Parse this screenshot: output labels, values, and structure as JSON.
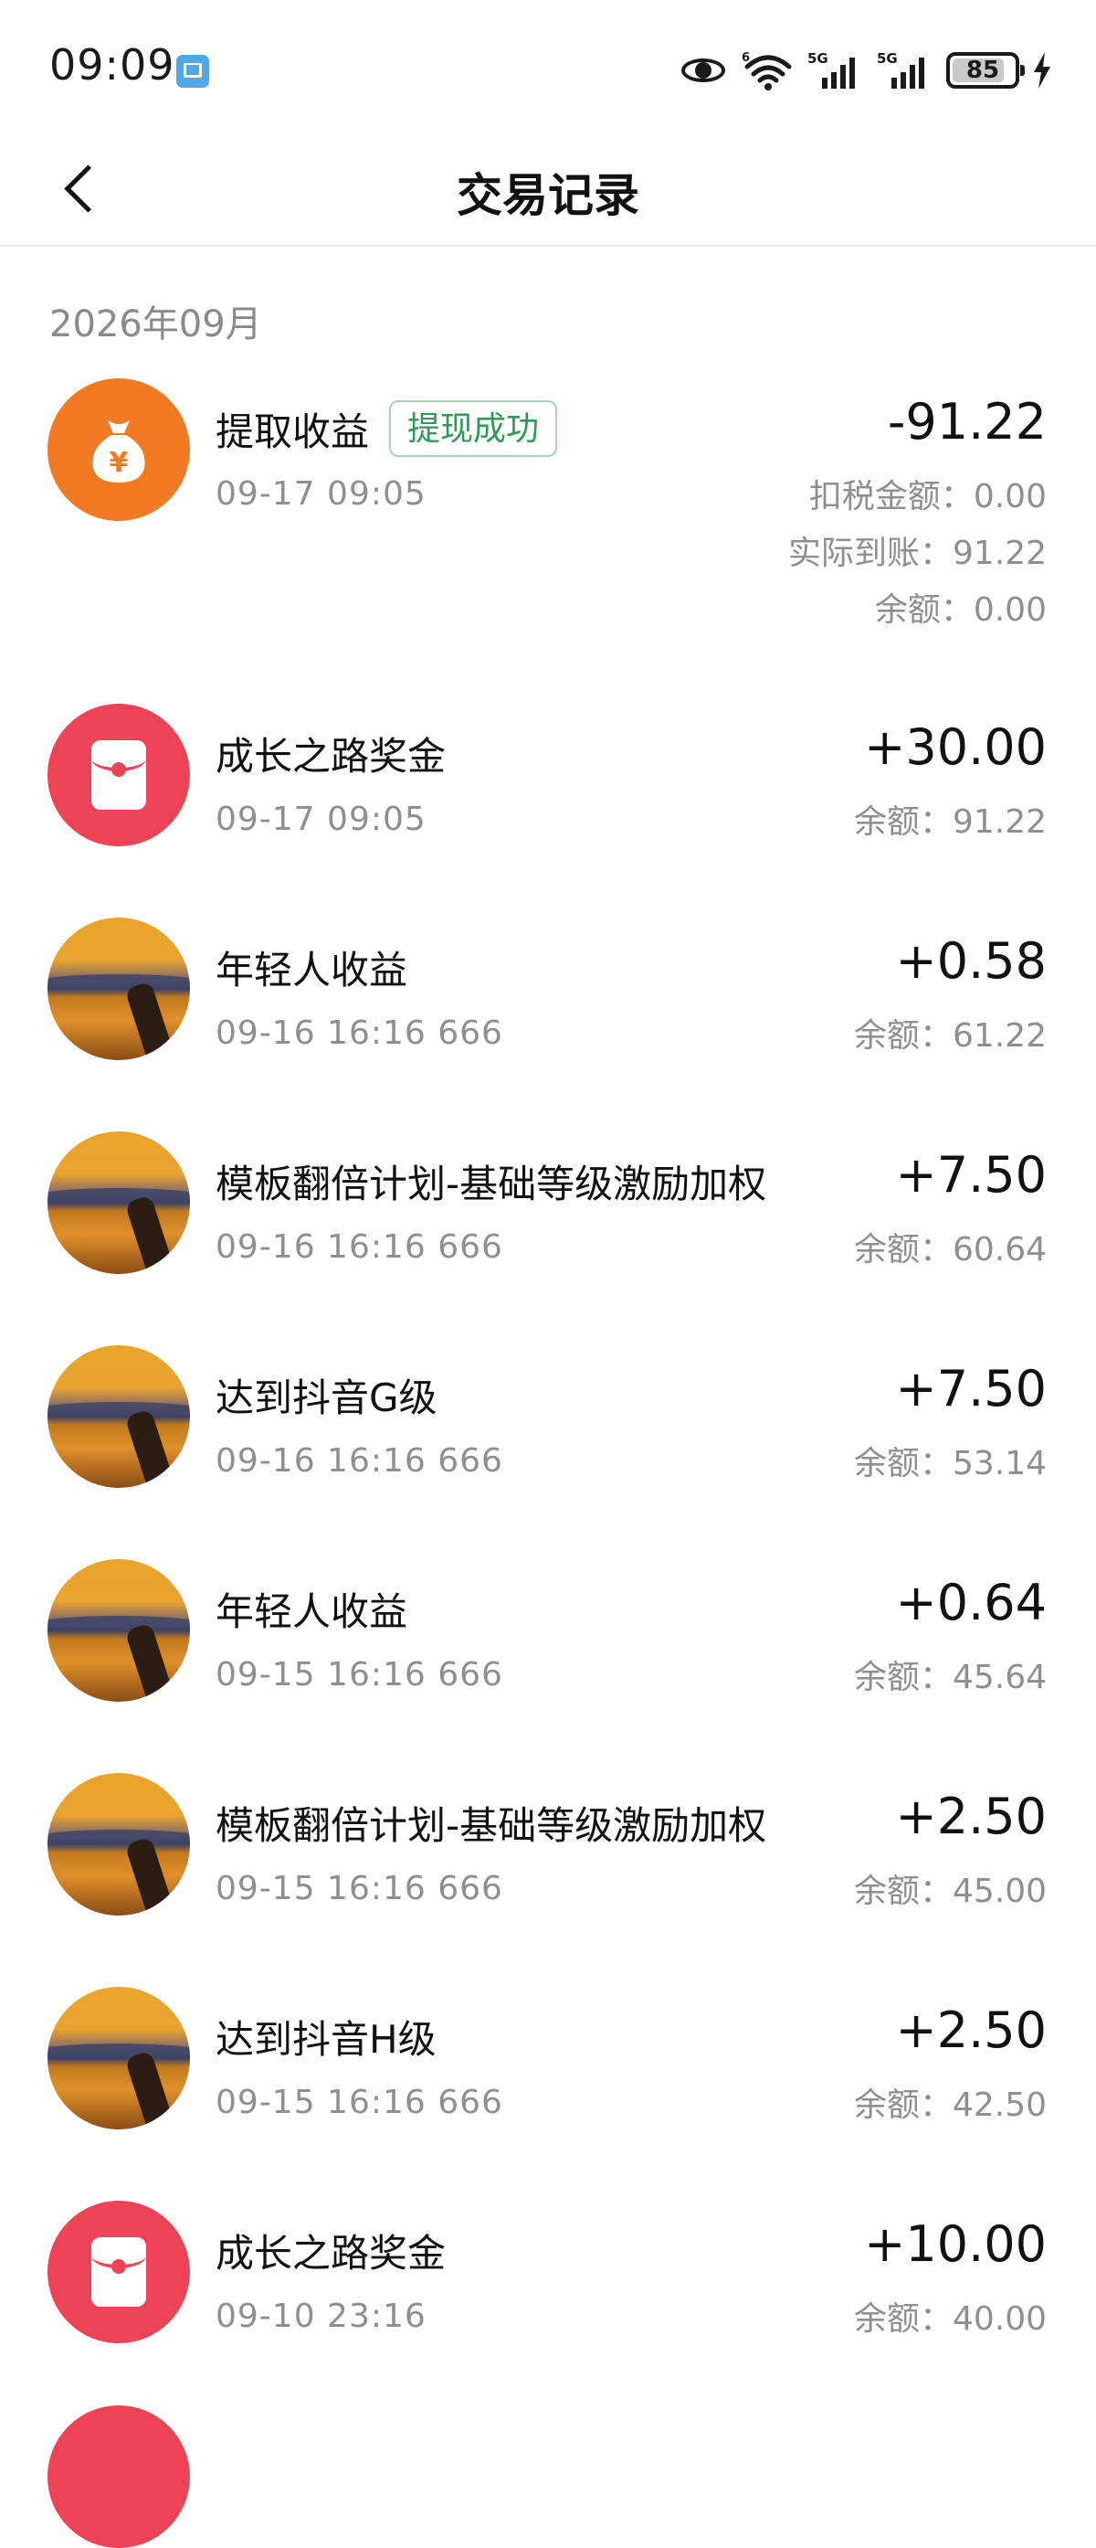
{
  "status_bar": {
    "time": "09:09",
    "app_icon": "book-app-icon",
    "wifi_badge": "6",
    "signal_1_label": "5G",
    "signal_2_label": "5G",
    "battery_level": "85",
    "battery_fraction": 0.85,
    "charging_icon": "lightning-icon"
  },
  "nav": {
    "back_icon": "chevron-left-icon",
    "title": "交易记录"
  },
  "month_label": "2026年09月",
  "colors": {
    "badge_green": "#2e9a55",
    "withdraw_orange": "#f27a22",
    "reward_red": "#ee4355",
    "secondary_gray": "#8f8f8f"
  },
  "transactions": [
    {
      "title": "提取收益",
      "badge": "提现成功",
      "time": "09-17 09:05",
      "amount": "-91.22",
      "details": [
        "扣税金额：0.00",
        "实际到账：91.22",
        "余额：0.00"
      ],
      "icon": "money-bag-icon"
    },
    {
      "title": "成长之路奖金",
      "time": "09-17 09:05",
      "amount": "+30.00",
      "details": [
        "余额：91.22"
      ],
      "icon": "red-packet-icon"
    },
    {
      "title": "年轻人收益",
      "time": "09-16 16:16 666",
      "amount": "+0.58",
      "details": [
        "余额：61.22"
      ],
      "icon": "sunset-photo-avatar"
    },
    {
      "title": "模板翻倍计划-基础等级激励加权",
      "time": "09-16 16:16 666",
      "amount": "+7.50",
      "details": [
        "余额：60.64"
      ],
      "icon": "sunset-photo-avatar"
    },
    {
      "title": "达到抖音G级",
      "time": "09-16 16:16 666",
      "amount": "+7.50",
      "details": [
        "余额：53.14"
      ],
      "icon": "sunset-photo-avatar"
    },
    {
      "title": "年轻人收益",
      "time": "09-15 16:16 666",
      "amount": "+0.64",
      "details": [
        "余额：45.64"
      ],
      "icon": "sunset-photo-avatar"
    },
    {
      "title": "模板翻倍计划-基础等级激励加权",
      "time": "09-15 16:16 666",
      "amount": "+2.50",
      "details": [
        "余额：45.00"
      ],
      "icon": "sunset-photo-avatar"
    },
    {
      "title": "达到抖音H级",
      "time": "09-15 16:16 666",
      "amount": "+2.50",
      "details": [
        "余额：42.50"
      ],
      "icon": "sunset-photo-avatar"
    },
    {
      "title": "成长之路奖金",
      "time": "09-10 23:16",
      "amount": "+10.00",
      "details": [
        "余额：40.00"
      ],
      "icon": "red-packet-icon"
    }
  ]
}
